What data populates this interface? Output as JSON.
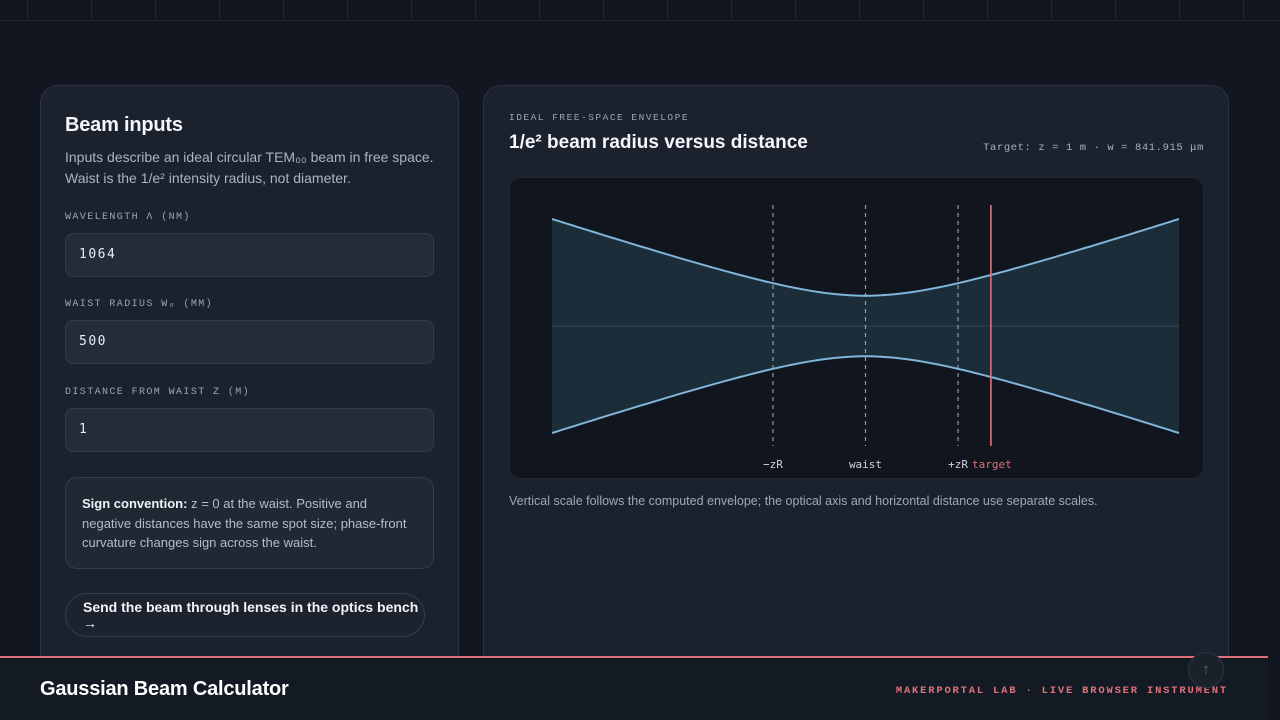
{
  "inputs_panel": {
    "title": "Beam inputs",
    "description": "Inputs describe an ideal circular TEM₀₀ beam in free space. Waist is the 1/e² intensity radius, not diameter.",
    "fields": [
      {
        "label": "WAVELENGTH λ (NM)",
        "value": "1064"
      },
      {
        "label": "WAIST RADIUS W₀ (MM)",
        "value": "500"
      },
      {
        "label": "DISTANCE FROM WAIST Z (M)",
        "value": "1"
      }
    ],
    "note": {
      "bold": "Sign convention:",
      "text": "z = 0 at the waist. Positive and negative distances have the same spot size; phase-front curvature changes sign across the waist."
    },
    "bench_button": "Send the beam through lenses in the optics bench →"
  },
  "chart_panel": {
    "eyebrow": "IDEAL FREE-SPACE ENVELOPE",
    "title": "1/e² beam radius versus distance",
    "target_readout": "Target: z = 1 m · w = 841.915 μm",
    "caption": "Vertical scale follows the computed envelope; the optical axis and horizontal distance use separate scales."
  },
  "chart_data": {
    "type": "area",
    "quantity": "1/e² beam radius w(z)",
    "wavelength_nm": 1064,
    "waist_radius": 500,
    "z_rayleigh": 0.738,
    "x": [
      -2.5,
      -2.0,
      -1.5,
      -1.0,
      -0.738,
      -0.5,
      0,
      0.5,
      0.738,
      1.0,
      1.5,
      2.0,
      2.5
    ],
    "w_relative": [
      3.53,
      2.89,
      2.26,
      1.68,
      1.41,
      1.21,
      1.0,
      1.21,
      1.41,
      1.68,
      2.26,
      2.89,
      3.53
    ],
    "x_range": [
      -2.5,
      2.5
    ],
    "markers": [
      {
        "label": "−zR",
        "x": -0.738,
        "style": "dashed"
      },
      {
        "label": "waist",
        "x": 0,
        "style": "dashed"
      },
      {
        "label": "+zR",
        "x": 0.738,
        "style": "dashed"
      },
      {
        "label": "target",
        "x": 1.0,
        "style": "solid",
        "color": "#e0717a"
      }
    ],
    "colors": {
      "envelope": "#7fb5d9",
      "fill": "#1f3140",
      "target": "#e0717a",
      "marker": "#b8c2cf"
    }
  },
  "footer": {
    "title": "Gaussian Beam Calculator",
    "right_text": "MAKERPORTAL LAB · LIVE BROWSER INSTRUMENT"
  },
  "scroll_top_icon": "arrow-up-icon"
}
